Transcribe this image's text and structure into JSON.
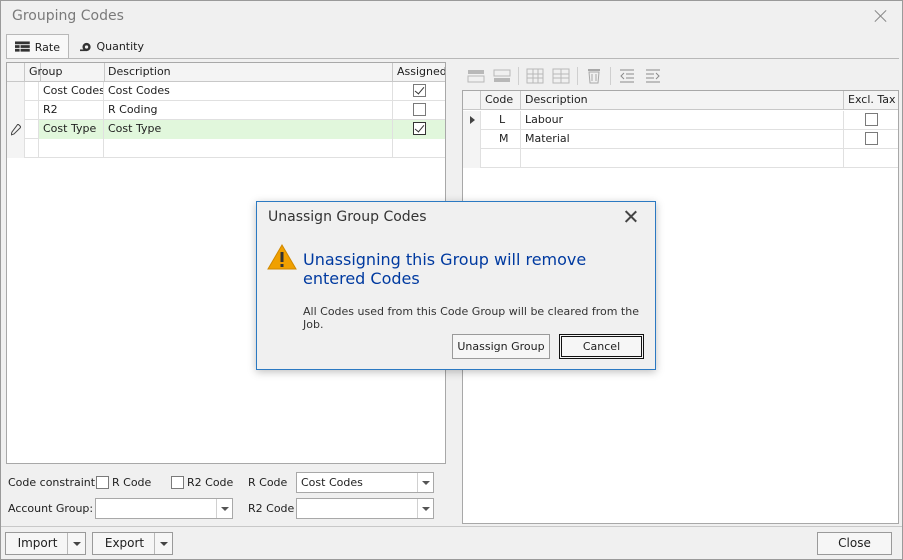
{
  "window": {
    "title": "Grouping Codes"
  },
  "tabs": [
    {
      "label": "Rate",
      "icon": "grid-table-icon"
    },
    {
      "label": "Quantity",
      "icon": "tape-measure-icon"
    }
  ],
  "group_grid": {
    "columns": [
      "Group",
      "Description",
      "Assigned"
    ],
    "rows": [
      {
        "group": "Cost Codes",
        "description": "Cost Codes",
        "assigned": true
      },
      {
        "group": "R2",
        "description": "R Coding",
        "assigned": false
      },
      {
        "group": "Cost Type",
        "description": "Cost Type",
        "assigned": true
      }
    ]
  },
  "code_grid": {
    "columns": [
      "Code",
      "Description",
      "Excl. Tax"
    ],
    "rows": [
      {
        "code": "L",
        "description": "Labour",
        "excl_tax": false
      },
      {
        "code": "M",
        "description": "Material",
        "excl_tax": false
      }
    ]
  },
  "constraints": {
    "code_constraint_label": "Code constraint:",
    "r_code_check": "R Code",
    "r2_code_check": "R2 Code",
    "r_code_label": "R Code",
    "r_code_value": "Cost Codes",
    "account_group_label": "Account Group:",
    "account_group_value": "",
    "r2_code_label": "R2 Code",
    "r2_code_value": ""
  },
  "footer": {
    "import": "Import",
    "export": "Export",
    "close": "Close"
  },
  "dialog": {
    "title": "Unassign Group Codes",
    "heading": "Unassigning this Group will remove entered Codes",
    "message": "All Codes used from this Code Group will be cleared from the Job.",
    "confirm": "Unassign Group",
    "cancel": "Cancel"
  },
  "colors": {
    "accent": "#2b79c2",
    "heading": "#003aa0",
    "selected_row": "#e1f7dc",
    "warning": "#f0a000"
  }
}
